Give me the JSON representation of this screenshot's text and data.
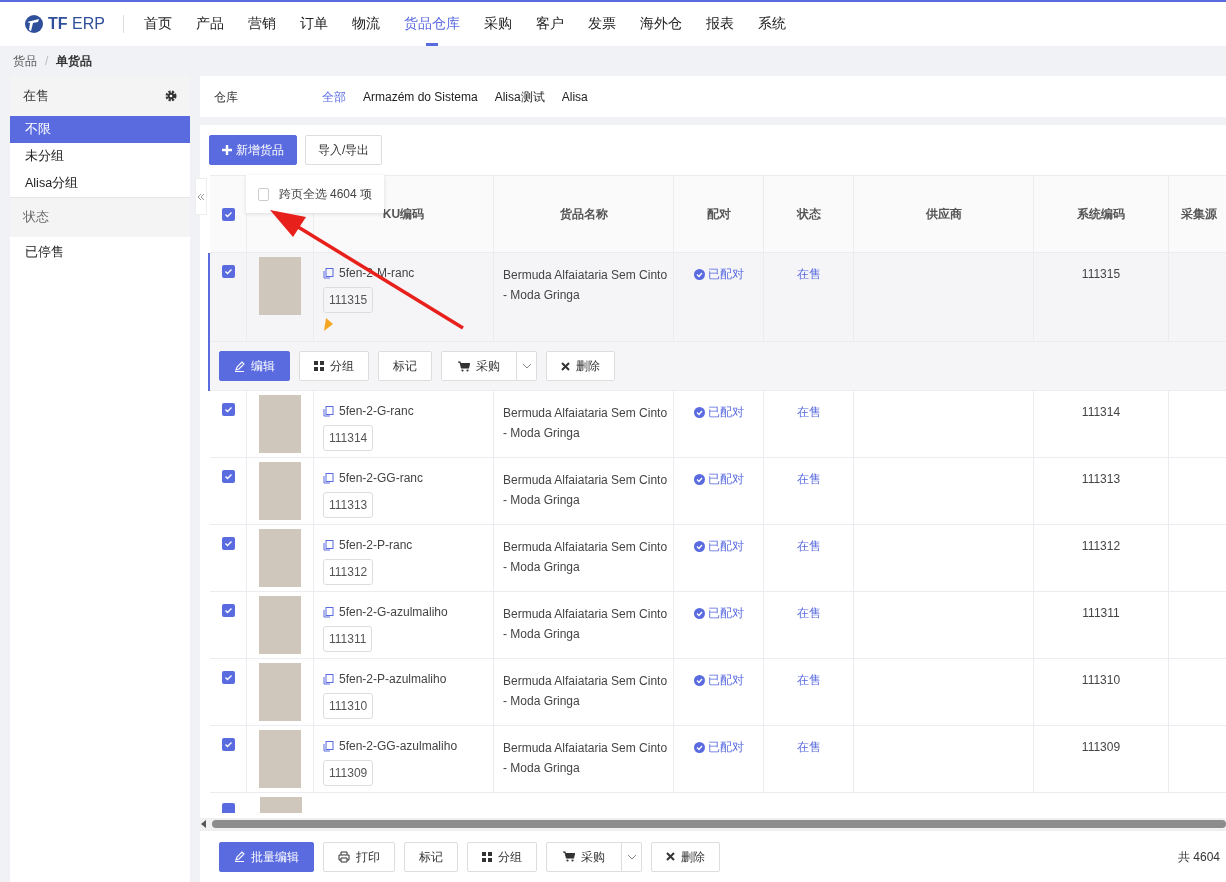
{
  "app": {
    "logo": "**TF** ERP"
  },
  "nav": [
    {
      "label": "首页",
      "selected": false
    },
    {
      "label": "产品",
      "selected": false
    },
    {
      "label": "营销",
      "selected": false
    },
    {
      "label": "订单",
      "selected": false
    },
    {
      "label": "物流",
      "selected": false
    },
    {
      "label": "货品仓库",
      "selected": true
    },
    {
      "label": "采购",
      "selected": false
    },
    {
      "label": "客户",
      "selected": false
    },
    {
      "label": "发票",
      "selected": false
    },
    {
      "label": "海外仓",
      "selected": false
    },
    {
      "label": "报表",
      "selected": false
    },
    {
      "label": "系统",
      "selected": false
    }
  ],
  "breadcrumb": {
    "items": [
      "货品",
      "单货品"
    ],
    "separator": "/"
  },
  "sidebar": [
    {
      "title": "在售",
      "settings": true,
      "items": [
        {
          "label": "不限",
          "selected": true
        },
        {
          "label": "未分组",
          "selected": false
        },
        {
          "label": "Alisa分组",
          "selected": false
        }
      ]
    },
    {
      "title": "状态",
      "settings": false,
      "items": [
        {
          "label": "已停售",
          "selected": false
        }
      ]
    }
  ],
  "warehouse_filter": {
    "label": "仓库",
    "options": [
      {
        "label": "全部",
        "selected": true
      },
      {
        "label": "Armazém do Sistema",
        "selected": false
      },
      {
        "label": "Alisa测试",
        "selected": false
      },
      {
        "label": "Alisa",
        "selected": false
      }
    ]
  },
  "toolbar": [
    {
      "label": "新增货品",
      "kind": "add"
    },
    {
      "label": "导入/导出",
      "kind": "plain"
    }
  ],
  "select_all_popover": {
    "label": "跨页全选 4604 项",
    "checked": false
  },
  "table": {
    "header_checked": true,
    "columns": [
      "KU编码",
      "货品名称",
      "配对",
      "状态",
      "供应商",
      "系统编码",
      "采集源"
    ],
    "rows": [
      {
        "checked": true,
        "expanded": true,
        "flag": true,
        "sku": "5fen-2-M-ranc",
        "code": "111315",
        "name": "Bermuda Alfaiataria Sem Cinto - Moda Gringa",
        "pairing": "已配对",
        "status": "在售",
        "system_code": "111315"
      },
      {
        "checked": true,
        "expanded": false,
        "flag": false,
        "sku": "5fen-2-G-ranc",
        "code": "111314",
        "name": "Bermuda Alfaiataria Sem Cinto - Moda Gringa",
        "pairing": "已配对",
        "status": "在售",
        "system_code": "111314"
      },
      {
        "checked": true,
        "expanded": false,
        "flag": false,
        "sku": "5fen-2-GG-ranc",
        "code": "111313",
        "name": "Bermuda Alfaiataria Sem Cinto - Moda Gringa",
        "pairing": "已配对",
        "status": "在售",
        "system_code": "111313"
      },
      {
        "checked": true,
        "expanded": false,
        "flag": false,
        "sku": "5fen-2-P-ranc",
        "code": "111312",
        "name": "Bermuda Alfaiataria Sem Cinto - Moda Gringa",
        "pairing": "已配对",
        "status": "在售",
        "system_code": "111312"
      },
      {
        "checked": true,
        "expanded": false,
        "flag": false,
        "sku": "5fen-2-G-azulmaliho",
        "code": "111311",
        "name": "Bermuda Alfaiataria Sem Cinto - Moda Gringa",
        "pairing": "已配对",
        "status": "在售",
        "system_code": "111311"
      },
      {
        "checked": true,
        "expanded": false,
        "flag": false,
        "sku": "5fen-2-P-azulmaliho",
        "code": "111310",
        "name": "Bermuda Alfaiataria Sem Cinto - Moda Gringa",
        "pairing": "已配对",
        "status": "在售",
        "system_code": "111310"
      },
      {
        "checked": true,
        "expanded": false,
        "flag": false,
        "sku": "5fen-2-GG-azulmaliho",
        "code": "111309",
        "name": "Bermuda Alfaiataria Sem Cinto - Moda Gringa",
        "pairing": "已配对",
        "status": "在售",
        "system_code": "111309"
      }
    ],
    "partial_row": {
      "checked": true
    },
    "row_actions": [
      {
        "label": "编辑",
        "kind": "edit"
      },
      {
        "label": "分组",
        "kind": "group"
      },
      {
        "label": "标记",
        "kind": "plain"
      },
      {
        "label": "采购",
        "kind": "purchase"
      },
      {
        "label": "删除",
        "kind": "delete"
      }
    ]
  },
  "bottom_actions": [
    {
      "label": "批量编辑",
      "kind": "edit"
    },
    {
      "label": "打印",
      "kind": "print"
    },
    {
      "label": "标记",
      "kind": "plain"
    },
    {
      "label": "分组",
      "kind": "group"
    },
    {
      "label": "采购",
      "kind": "purchase"
    },
    {
      "label": "删除",
      "kind": "delete"
    }
  ],
  "total": "共 4604"
}
